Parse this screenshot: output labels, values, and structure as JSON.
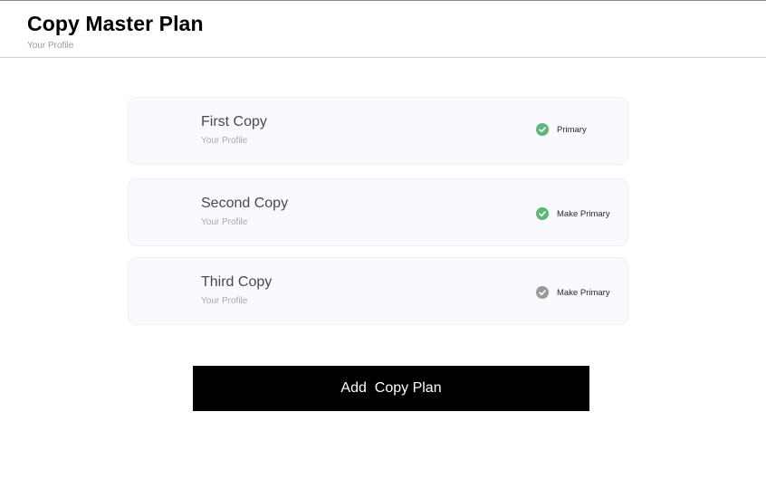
{
  "header": {
    "title": "Copy Master Plan",
    "subtitle": "Your Profile"
  },
  "plans": [
    {
      "name": "First Copy",
      "subtitle": "Your Profile",
      "status_label": "Primary",
      "status_icon": "check-circle-icon",
      "icon_color": "#5cb878"
    },
    {
      "name": "Second Copy",
      "subtitle": "Your Profile",
      "status_label": "Make Primary",
      "status_icon": "check-circle-icon",
      "icon_color": "#5cb878"
    },
    {
      "name": "Third Copy",
      "subtitle": "Your Profile",
      "status_label": "Make Primary",
      "status_icon": "check-circle-icon",
      "icon_color": "#9a9a9a"
    }
  ],
  "actions": {
    "add_label": "Add  Copy Plan"
  },
  "colors": {
    "accent": "#000000",
    "success": "#5cb878",
    "inactive": "#9a9a9a",
    "card_background": "#f9f9fe"
  }
}
